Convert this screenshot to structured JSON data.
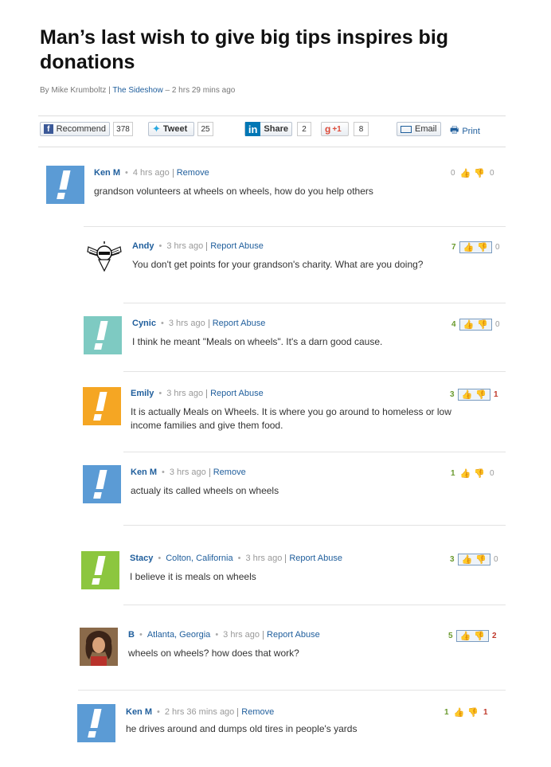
{
  "article": {
    "title": "Man’s last wish to give big tips inspires big donations",
    "byline_prefix": "By Mike Krumboltz |",
    "source": "The Sideshow",
    "time": "– 2 hrs 29 mins ago"
  },
  "share": {
    "recommend": "Recommend",
    "recommend_count": "378",
    "tweet": "Tweet",
    "tweet_count": "25",
    "share": "Share",
    "share_count": "2",
    "gplus": "+1",
    "gplus_count": "8",
    "email": "Email",
    "print": "Print"
  },
  "colors": {
    "link": "#1f5e9c",
    "up": "#6a9a2e",
    "down": "#c0392b"
  },
  "comments": [
    {
      "name": "Ken M",
      "location": "",
      "time": "4 hrs ago",
      "action": "Remove",
      "text": "grandson volunteers at wheels on wheels, how do you help others",
      "up": "0",
      "down": "0",
      "avatar": "exclamation-blue",
      "color": "#5b9bd5"
    },
    {
      "name": "Andy",
      "location": "",
      "time": "3 hrs ago",
      "action": "Report Abuse",
      "text": "You don't get points for your grandson's charity. What are you doing?",
      "up": "7",
      "down": "0",
      "avatar": "winged-knight",
      "color": "#000000"
    },
    {
      "name": "Cynic",
      "location": "",
      "time": "3 hrs ago",
      "action": "Report Abuse",
      "text": "I think he meant \"Meals on wheels\". It's a darn good cause.",
      "up": "4",
      "down": "0",
      "avatar": "exclamation-teal",
      "color": "#7ecac2"
    },
    {
      "name": "Emily",
      "location": "",
      "time": "3 hrs ago",
      "action": "Report Abuse",
      "text_line1": "It is actually Meals on Wheels. It is where you go around to homeless or low",
      "text_line2": "income families and give them food.",
      "up": "3",
      "down": "1",
      "avatar": "exclamation-orange",
      "color": "#f5a623"
    },
    {
      "name": "Ken M",
      "location": "",
      "time": "3 hrs ago",
      "action": "Remove",
      "text": "actualy its called wheels on wheels",
      "up": "1",
      "down": "0",
      "avatar": "exclamation-blue",
      "color": "#5b9bd5"
    },
    {
      "name": "Stacy",
      "location": "Colton, California",
      "time": "3 hrs ago",
      "action": "Report Abuse",
      "text": "I believe it is meals on wheels",
      "up": "3",
      "down": "0",
      "avatar": "exclamation-green",
      "color": "#8cc63f"
    },
    {
      "name": "B",
      "location": "Atlanta, Georgia",
      "time": "3 hrs ago",
      "action": "Report Abuse",
      "text": "wheels on wheels? how does that work?",
      "up": "5",
      "down": "2",
      "avatar": "photo-man",
      "color": "#7a4a36"
    },
    {
      "name": "Ken M",
      "location": "",
      "time": "2 hrs 36 mins ago",
      "action": "Remove",
      "text": "he drives around and dumps old tires in people's yards",
      "up": "1",
      "down": "1",
      "avatar": "exclamation-blue",
      "color": "#5b9bd5"
    }
  ]
}
